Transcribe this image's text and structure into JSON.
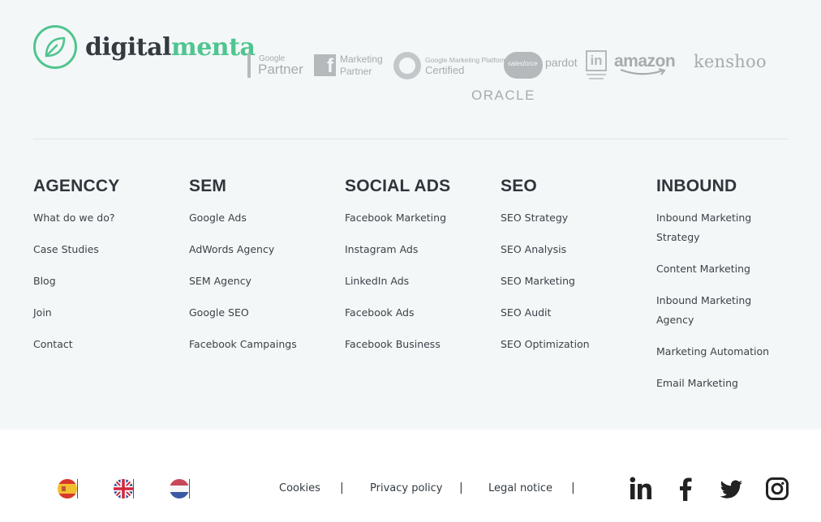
{
  "brand": {
    "name_part1": "digital",
    "name_part2": "menta"
  },
  "partners": {
    "google_partner_small": "Google",
    "google_partner_big": "Partner",
    "fb_line1": "Marketing",
    "fb_line2": "Partner",
    "gmp_line1": "Google Marketing Platform",
    "gmp_line2": "Certified",
    "salesforce": "salesforce",
    "pardot": "pardot",
    "linkedin": "in",
    "amazon": "amazon",
    "kenshoo": "kenshoo",
    "oracle": "ORACLE"
  },
  "columns": [
    {
      "title": "AGENCCY",
      "links": [
        "What do we do?",
        "Case Studies",
        "Blog",
        "Join",
        "Contact"
      ]
    },
    {
      "title": "SEM",
      "links": [
        "Google Ads",
        "AdWords Agency",
        "SEM Agency",
        "Google SEO",
        "Facebook Campaings"
      ]
    },
    {
      "title": "SOCIAL ADS",
      "links": [
        "Facebook Marketing",
        "Instagram Ads",
        "LinkedIn Ads",
        "Facebook Ads",
        "Facebook Business"
      ]
    },
    {
      "title": "SEO",
      "links": [
        "SEO Strategy",
        "SEO Analysis",
        "SEO Marketing",
        "SEO Audit",
        "SEO Optimization"
      ]
    },
    {
      "title": "INBOUND",
      "links": [
        "Inbound Marketing Strategy",
        "Content Marketing",
        "Inbound Marketing Agency",
        "Marketing Automation",
        "Email Marketing"
      ]
    }
  ],
  "legal": {
    "cookies": "Cookies",
    "privacy": "Privacy policy",
    "notice": "Legal notice",
    "separator": "|"
  },
  "colors": {
    "brand_green": "#4fc58f",
    "footer_bg": "#f4f7f8",
    "text_dark": "#333a40",
    "partner_gray": "#a7abae"
  },
  "icons": [
    "leaf-icon",
    "spain-flag-icon",
    "uk-flag-icon",
    "netherlands-flag-icon",
    "linkedin-icon",
    "facebook-icon",
    "twitter-icon",
    "instagram-icon"
  ]
}
